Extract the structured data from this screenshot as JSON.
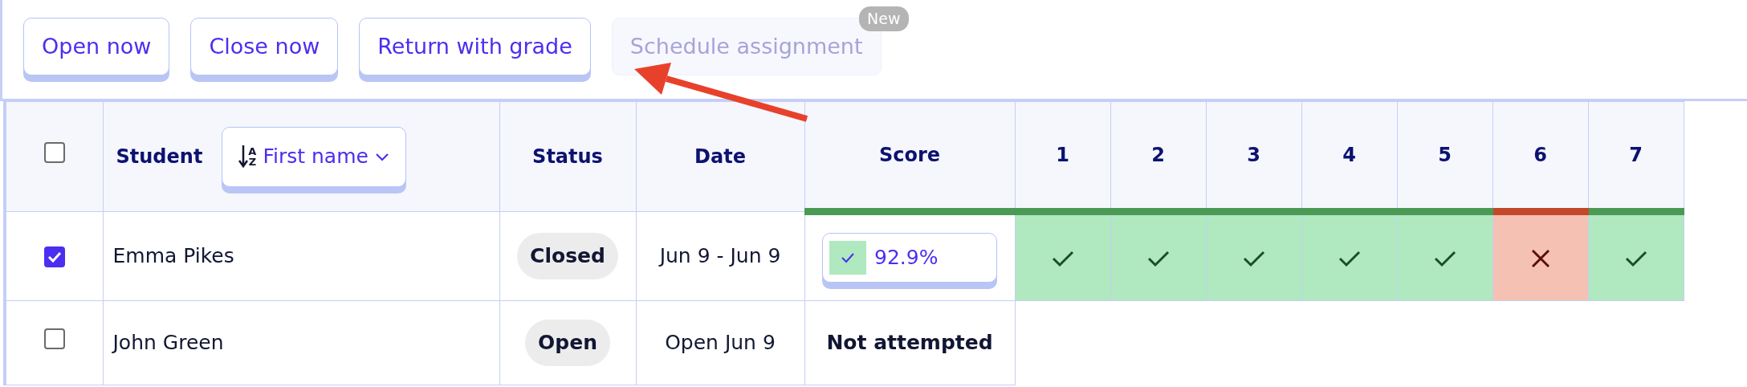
{
  "toolbar": {
    "buttons": [
      {
        "label": "Open now",
        "disabled": false
      },
      {
        "label": "Close now",
        "disabled": false
      },
      {
        "label": "Return with grade",
        "disabled": false
      },
      {
        "label": "Schedule assignment",
        "disabled": true,
        "badge": "New"
      }
    ]
  },
  "table": {
    "header": {
      "select_all": {
        "checked": false
      },
      "student": "Student",
      "sort": {
        "letters": [
          "A",
          "Z"
        ],
        "label": "First name"
      },
      "status": "Status",
      "date": "Date",
      "score": {
        "label": "Score",
        "correct": true
      },
      "questions": [
        {
          "label": "1",
          "correct": true
        },
        {
          "label": "2",
          "correct": true
        },
        {
          "label": "3",
          "correct": true
        },
        {
          "label": "4",
          "correct": true
        },
        {
          "label": "5",
          "correct": true
        },
        {
          "label": "6",
          "correct": false
        },
        {
          "label": "7",
          "correct": true
        }
      ]
    },
    "rows": [
      {
        "selected": true,
        "student": "Emma Pikes",
        "status": "Closed",
        "date": "Jun 9 - Jun 9",
        "score": {
          "kind": "graded",
          "text": "92.9%"
        },
        "answers": [
          {
            "correct": true
          },
          {
            "correct": true
          },
          {
            "correct": true
          },
          {
            "correct": true
          },
          {
            "correct": true
          },
          {
            "correct": false
          },
          {
            "correct": true
          }
        ]
      },
      {
        "selected": false,
        "student": "John Green",
        "status": "Open",
        "date": "Open Jun 9",
        "score": {
          "kind": "none",
          "text": "Not attempted"
        }
      }
    ]
  },
  "annotation": {
    "kind": "arrow"
  }
}
